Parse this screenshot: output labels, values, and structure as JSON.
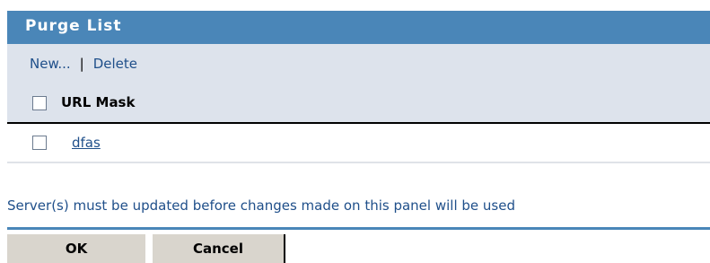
{
  "panel": {
    "title": "Purge List"
  },
  "toolbar": {
    "new_label": "New...",
    "separator": "|",
    "delete_label": "Delete"
  },
  "table": {
    "column_header": "URL Mask",
    "rows": [
      {
        "url_mask": "dfas",
        "checked": false
      }
    ]
  },
  "notice": "Server(s) must be updated before changes made on this panel will be used",
  "buttons": {
    "ok_label": "OK",
    "cancel_label": "Cancel"
  },
  "colors": {
    "accent": "#4a86b8",
    "link": "#1f4f8a",
    "button_bg": "#d9d5cd",
    "row_header_bg": "#dde3ec"
  }
}
